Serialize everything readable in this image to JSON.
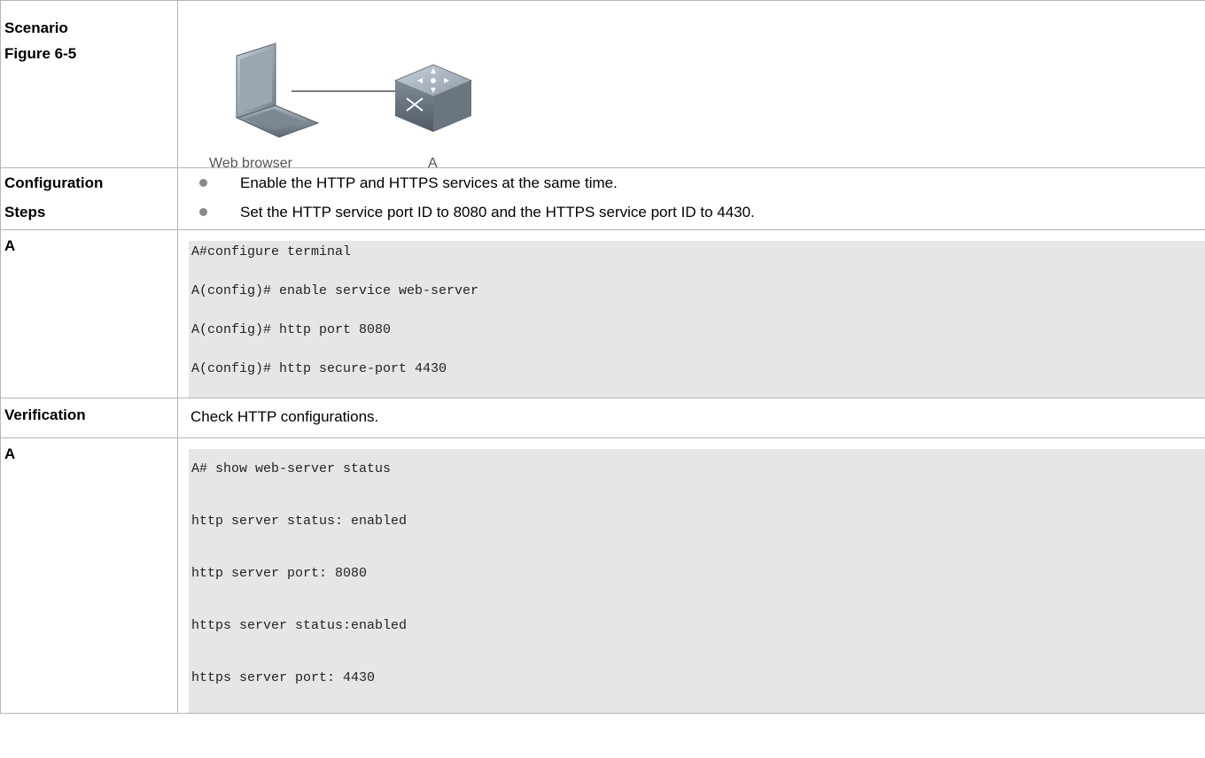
{
  "rows": {
    "scenario": {
      "labels": [
        "Scenario",
        "Figure 6-5"
      ],
      "figure": {
        "pc_caption": "Web browser",
        "switch_caption": "A",
        "pc_icon": "laptop-icon",
        "switch_icon": "switch-icon"
      }
    },
    "steps": {
      "labels": [
        "Configuration",
        "Steps"
      ],
      "bullets": [
        "Enable the HTTP and HTTPS services at the same time.",
        "Set the HTTP service port ID to 8080 and the HTTPS service port ID to 4430."
      ]
    },
    "config": {
      "label": "A",
      "lines": [
        "A#configure terminal",
        "A(config)# enable service web-server",
        "A(config)# http port 8080",
        "A(config)# http secure-port 4430"
      ]
    },
    "verification": {
      "label": "Verification",
      "text": "Check HTTP configurations."
    },
    "verify": {
      "label": "A",
      "lines": [
        "A# show web-server status",
        "http server status: enabled",
        "http server port: 8080",
        "https server status:enabled",
        "https server port: 4430"
      ]
    }
  }
}
